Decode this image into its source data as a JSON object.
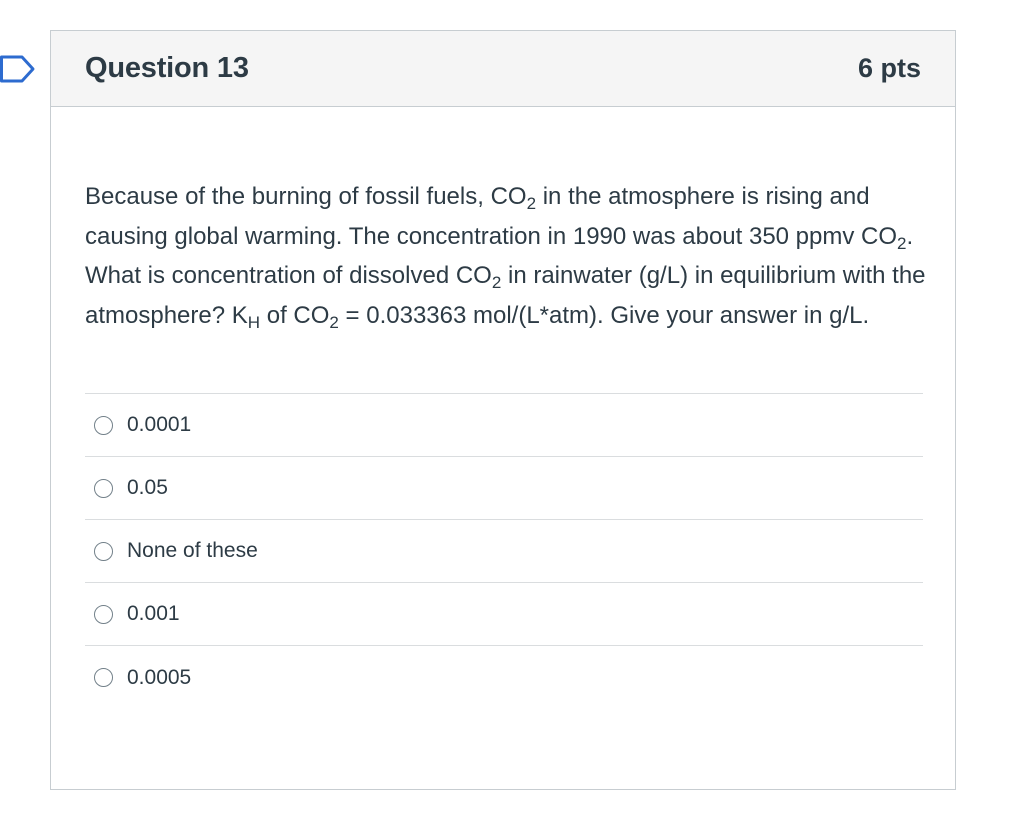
{
  "question": {
    "title": "Question 13",
    "points": "6 pts",
    "text_parts": {
      "p1": "Because of the burning of fossil fuels, CO",
      "sub1": "2",
      "p2": " in the atmosphere is rising and causing global warming. The concentration in 1990 was about 350 ppmv CO",
      "sub2": "2",
      "p3": ".  What is concentration of dissolved CO",
      "sub3": "2",
      "p4": " in rainwater (g/L) in equilibrium with the atmosphere? K",
      "sub4": "H",
      "p5": " of CO",
      "sub5": "2",
      "p6": " = 0.033363 mol/(L*atm). Give your answer in g/L."
    }
  },
  "answers": [
    {
      "label": "0.0001"
    },
    {
      "label": "0.05"
    },
    {
      "label": "None of these"
    },
    {
      "label": "0.001"
    },
    {
      "label": "0.0005"
    }
  ],
  "colors": {
    "text": "#2d3b45",
    "header_bg": "#f5f5f5",
    "border": "#c7cdd1",
    "bookmark_stroke": "#2d6bcf"
  },
  "icons": {
    "bookmark": "bookmark-flag-icon",
    "radio": "radio-unchecked-icon"
  }
}
